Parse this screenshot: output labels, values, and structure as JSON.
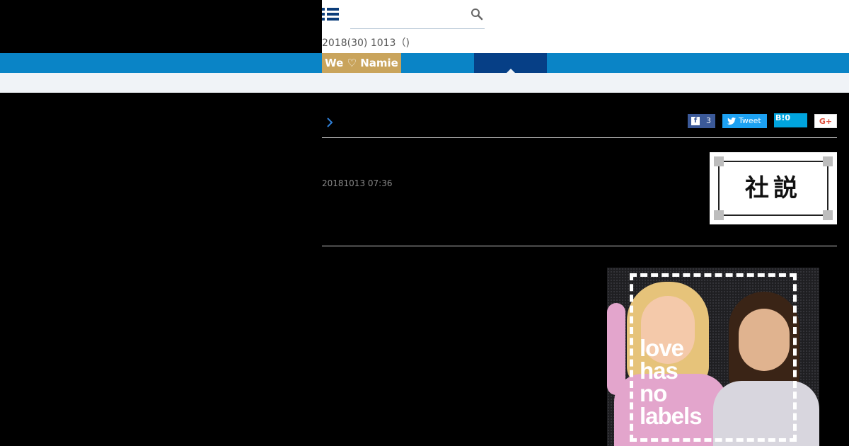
{
  "header": {
    "search": {
      "placeholder": "",
      "value": ""
    },
    "dateline": "2018(30) 1013（)"
  },
  "nav": {
    "items": [
      {
        "label": "We ♡ Namie",
        "color": "#c9a45c"
      },
      {
        "label": "",
        "color": "#063f86",
        "active": true
      }
    ],
    "bar_color": "#0a84c6"
  },
  "article": {
    "share": {
      "facebook_count": "3",
      "facebook_icon": "f",
      "tweet_label": "Tweet",
      "hatena_label": "B!0",
      "google_label": "G+"
    },
    "timestamp": "20181013 07:36",
    "badge_text": "社説",
    "photo": {
      "caption_lines": [
        "love",
        "has",
        "no",
        "labels"
      ]
    }
  }
}
